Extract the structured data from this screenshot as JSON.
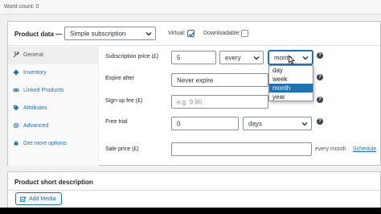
{
  "header": {
    "word_count": "Word count: 0"
  },
  "product_data": {
    "label": "Product data —",
    "type_selected": "Simple subscription",
    "virtual_label": "Virtual:",
    "virtual_checked": true,
    "downloadable_label": "Downloadable:",
    "downloadable_checked": false
  },
  "tabs": [
    {
      "label": "General",
      "icon": "wrench-icon",
      "active": true
    },
    {
      "label": "Inventory",
      "icon": "diamond-icon",
      "active": false
    },
    {
      "label": "Linked Products",
      "icon": "link-icon",
      "active": false
    },
    {
      "label": "Attributes",
      "icon": "tag-icon",
      "active": false
    },
    {
      "label": "Advanced",
      "icon": "gear-icon",
      "active": false
    },
    {
      "label": "Get more options",
      "icon": "plugin-icon",
      "active": false
    }
  ],
  "fields": {
    "subscription_price_label": "Subscription price (£)",
    "subscription_price_value": "5",
    "interval_value": "every",
    "period_value": "month",
    "period_options": [
      "day",
      "week",
      "month",
      "year"
    ],
    "period_selected_index": 2,
    "expire_label": "Expire after",
    "expire_value": "Never expire",
    "signup_label": "Sign-up fee (£)",
    "signup_placeholder": "e.g. 9.90",
    "trial_label": "Free trial",
    "trial_value": "0",
    "trial_period_value": "days",
    "sale_label": "Sale price (£)",
    "sale_value": "",
    "sale_suffix": "every month",
    "schedule_link": "Schedule",
    "help_glyph": "?"
  },
  "short_description": {
    "title": "Product short description",
    "add_media_label": "Add Media"
  },
  "colors": {
    "accent": "#2271b1",
    "border": "#8c8f94",
    "text": "#1d2327"
  }
}
